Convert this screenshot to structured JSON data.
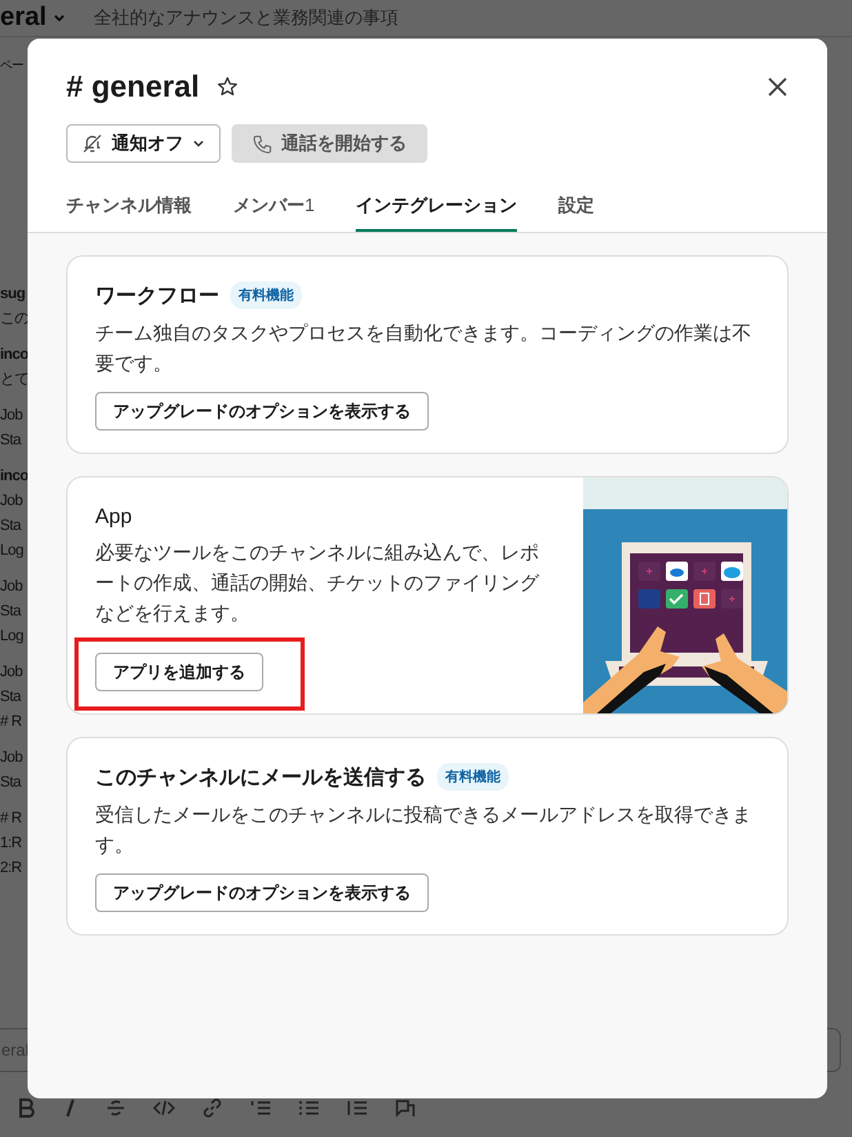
{
  "background": {
    "channel_name": "eral",
    "topic": "全社的なアナウンスと業務関連の事項",
    "side_label": "ペー",
    "composer_placeholder": "eral",
    "message_groups": [
      {
        "lines": [
          {
            "kind": "author",
            "text": "sug"
          },
          {
            "kind": "text",
            "text": "この"
          }
        ]
      },
      {
        "lines": [
          {
            "kind": "author",
            "text": "inco"
          },
          {
            "kind": "text",
            "text": "とて"
          }
        ]
      },
      {
        "lines": [
          {
            "kind": "text",
            "text": "Job"
          },
          {
            "kind": "text",
            "text": "Sta"
          }
        ]
      },
      {
        "lines": [
          {
            "kind": "author",
            "text": "inco"
          },
          {
            "kind": "text",
            "text": "Job"
          },
          {
            "kind": "text",
            "text": "Sta"
          },
          {
            "kind": "text",
            "text": "Log"
          }
        ]
      },
      {
        "lines": [
          {
            "kind": "text",
            "text": "Job"
          },
          {
            "kind": "text",
            "text": "Sta"
          },
          {
            "kind": "text",
            "text": "Log"
          }
        ]
      },
      {
        "lines": [
          {
            "kind": "text",
            "text": "Job"
          },
          {
            "kind": "text",
            "text": "Sta"
          },
          {
            "kind": "text",
            "text": "# R"
          }
        ]
      },
      {
        "lines": [
          {
            "kind": "text",
            "text": "Job"
          },
          {
            "kind": "text",
            "text": "Sta"
          }
        ]
      },
      {
        "lines": [
          {
            "kind": "text",
            "text": "# R"
          },
          {
            "kind": "text",
            "text": "1:R"
          },
          {
            "kind": "text",
            "text": "2:R"
          }
        ]
      }
    ]
  },
  "modal": {
    "title": "# general",
    "buttons": [
      {
        "kind": "notify",
        "label": "通知オフ"
      },
      {
        "kind": "call",
        "label": "通話を開始する"
      }
    ],
    "tabs": [
      {
        "label": "チャンネル情報",
        "selected": false
      },
      {
        "label": "メンバー",
        "count": "1",
        "selected": false
      },
      {
        "label": "インテグレーション",
        "selected": true
      },
      {
        "label": "設定",
        "selected": false
      }
    ],
    "cards": [
      {
        "kind": "feature",
        "title": "ワークフロー",
        "badge": "有料機能",
        "description": "チーム独自のタスクやプロセスを自動化できます。コーディングの作業は不要です。",
        "button": "アップグレードのオプションを表示する",
        "highlighted": false
      },
      {
        "kind": "app",
        "title": "App",
        "description": "必要なツールをこのチャンネルに組み込んで、レポートの作成、通話の開始、チケットのファイリングなどを行えます。",
        "button": "アプリを追加する",
        "highlighted": true
      },
      {
        "kind": "feature",
        "title": "このチャンネルにメールを送信する",
        "badge": "有料機能",
        "description": "受信したメールをこのチャンネルに投稿できるメールアドレスを取得できます。",
        "button": "アップグレードのオプションを表示する",
        "highlighted": false
      }
    ]
  }
}
